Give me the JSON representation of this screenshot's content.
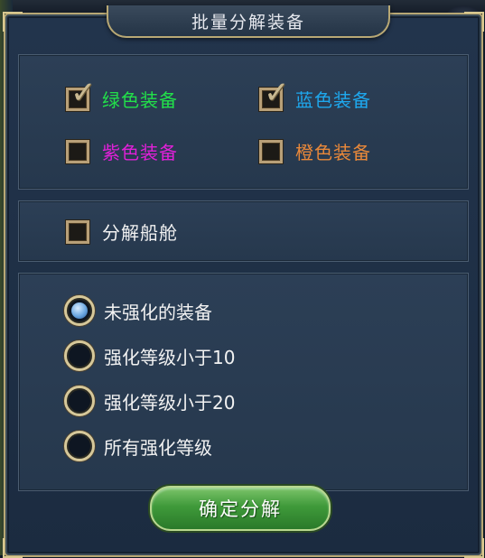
{
  "dialog": {
    "title": "批量分解装备",
    "confirm_label": "确定分解"
  },
  "quality_filters": [
    {
      "label": "绿色装备",
      "checked": true,
      "color": "#22e04a"
    },
    {
      "label": "蓝色装备",
      "checked": true,
      "color": "#1ea8ee"
    },
    {
      "label": "紫色装备",
      "checked": false,
      "color": "#e020d8"
    },
    {
      "label": "橙色装备",
      "checked": false,
      "color": "#e8883a"
    }
  ],
  "hull_option": {
    "label": "分解船舱",
    "checked": false,
    "color": "#f2f2f2"
  },
  "enhance_options": [
    {
      "label": "未强化的装备",
      "selected": true
    },
    {
      "label": "强化等级小于10",
      "selected": false
    },
    {
      "label": "强化等级小于20",
      "selected": false
    },
    {
      "label": "所有强化等级",
      "selected": false
    }
  ],
  "icons": {
    "check": "✓"
  }
}
